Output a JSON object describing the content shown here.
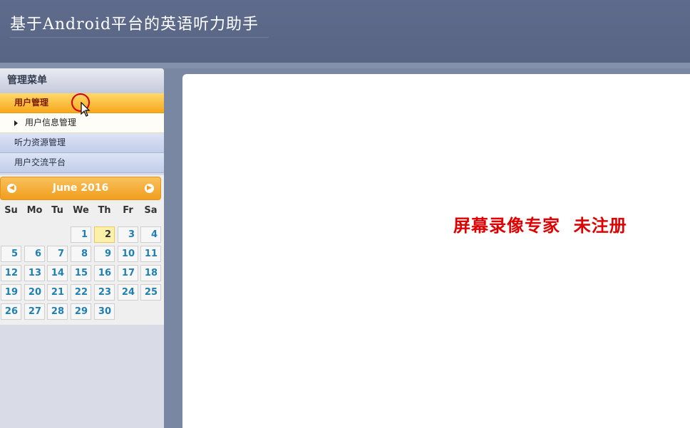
{
  "app": {
    "title": "基于Android平台的英语听力助手"
  },
  "sidebar": {
    "header": "管理菜单",
    "items": [
      {
        "label": "用户管理",
        "active": true
      },
      {
        "label": "听力资源管理",
        "active": false
      },
      {
        "label": "用户交流平台",
        "active": false
      }
    ],
    "submenu": {
      "label": "用户信息管理"
    }
  },
  "calendar": {
    "month_label": "June 2016",
    "prev_icon": "prev-month-icon",
    "next_icon": "next-month-icon",
    "weekdays": [
      "Su",
      "Mo",
      "Tu",
      "We",
      "Th",
      "Fr",
      "Sa"
    ],
    "first_weekday_index": 3,
    "days": [
      1,
      2,
      3,
      4,
      5,
      6,
      7,
      8,
      9,
      10,
      11,
      12,
      13,
      14,
      15,
      16,
      17,
      18,
      19,
      20,
      21,
      22,
      23,
      24,
      25,
      26,
      27,
      28,
      29,
      30
    ],
    "today": 2
  },
  "content": {
    "watermark": "屏幕录像专家  未注册"
  },
  "colors": {
    "accent": "#f19e1c",
    "header_bg": "#5f6b8c",
    "link": "#1e7fb3",
    "watermark": "#e00000"
  }
}
